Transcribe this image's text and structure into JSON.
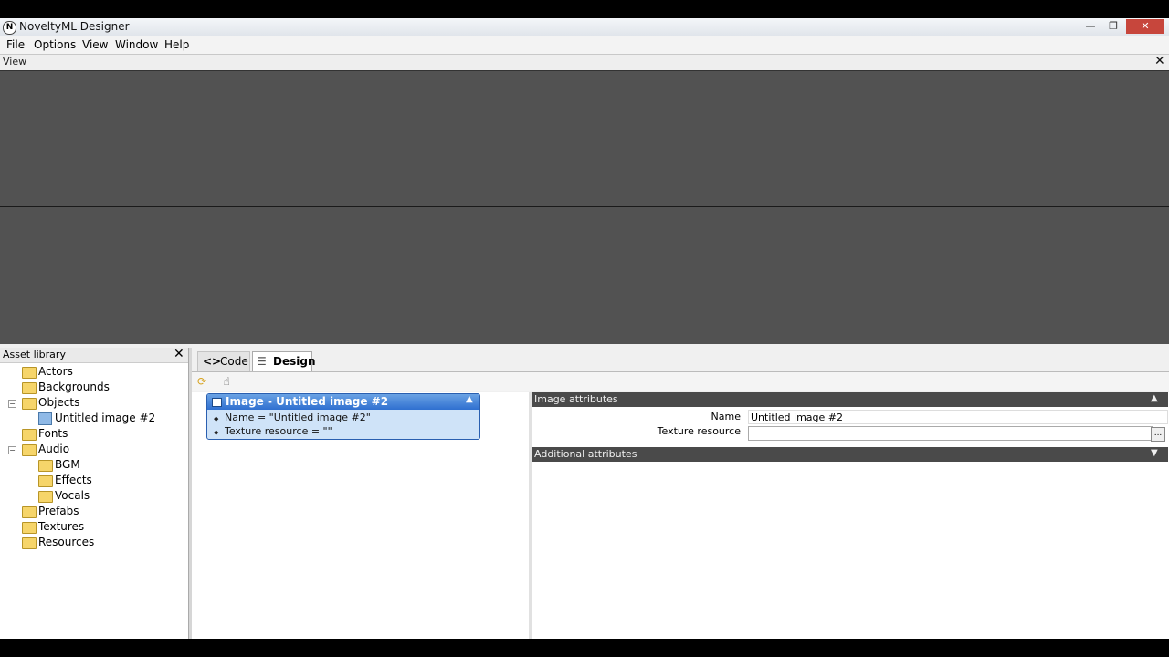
{
  "window": {
    "title": "NoveltyML Designer",
    "app_icon_glyph": "N",
    "controls": {
      "minimize": "—",
      "maximize": "❐",
      "close": "✕"
    }
  },
  "menu": [
    "File",
    "Options",
    "View",
    "Window",
    "Help"
  ],
  "view_panel": {
    "label": "View",
    "close": "✕"
  },
  "asset_library": {
    "label": "Asset library",
    "close": "✕",
    "items": [
      {
        "label": "Actors",
        "icon": "folder-icon",
        "level": 0
      },
      {
        "label": "Backgrounds",
        "icon": "folder-icon",
        "level": 0
      },
      {
        "label": "Objects",
        "icon": "folder-icon",
        "level": 0,
        "expanded": true
      },
      {
        "label": "Untitled image #2",
        "icon": "image-icon",
        "level": 1
      },
      {
        "label": "Fonts",
        "icon": "folder-icon",
        "level": 0
      },
      {
        "label": "Audio",
        "icon": "folder-icon",
        "level": 0,
        "expanded": true
      },
      {
        "label": "BGM",
        "icon": "folder-icon",
        "level": 1
      },
      {
        "label": "Effects",
        "icon": "folder-icon",
        "level": 1
      },
      {
        "label": "Vocals",
        "icon": "folder-icon",
        "level": 1
      },
      {
        "label": "Prefabs",
        "icon": "folder-icon",
        "level": 0
      },
      {
        "label": "Textures",
        "icon": "folder-icon",
        "level": 0
      },
      {
        "label": "Resources",
        "icon": "folder-icon",
        "level": 0
      }
    ]
  },
  "tabs": {
    "code": "Code",
    "design": "Design",
    "code_glyph": "<>",
    "design_glyph": "☰"
  },
  "toolbar": {
    "refresh_glyph": "⟳",
    "pointer_glyph": "☝"
  },
  "node": {
    "title": "Image - Untitled image #2",
    "attr1": "Name = \"Untitled image #2\"",
    "attr2": "Texture resource = \"\"",
    "bullet": "◆",
    "collapse": "▲"
  },
  "properties": {
    "section1": "Image attributes",
    "section1_arrow": "▲",
    "name_label": "Name",
    "name_value": "Untitled image #2",
    "texture_label": "Texture resource",
    "texture_value": "",
    "ellipsis": "...",
    "section2": "Additional attributes",
    "section2_arrow": "▼"
  },
  "colors": {
    "canvas": "#525252",
    "node_header": "#2f6fd0",
    "section_header": "#4a4a4a"
  }
}
